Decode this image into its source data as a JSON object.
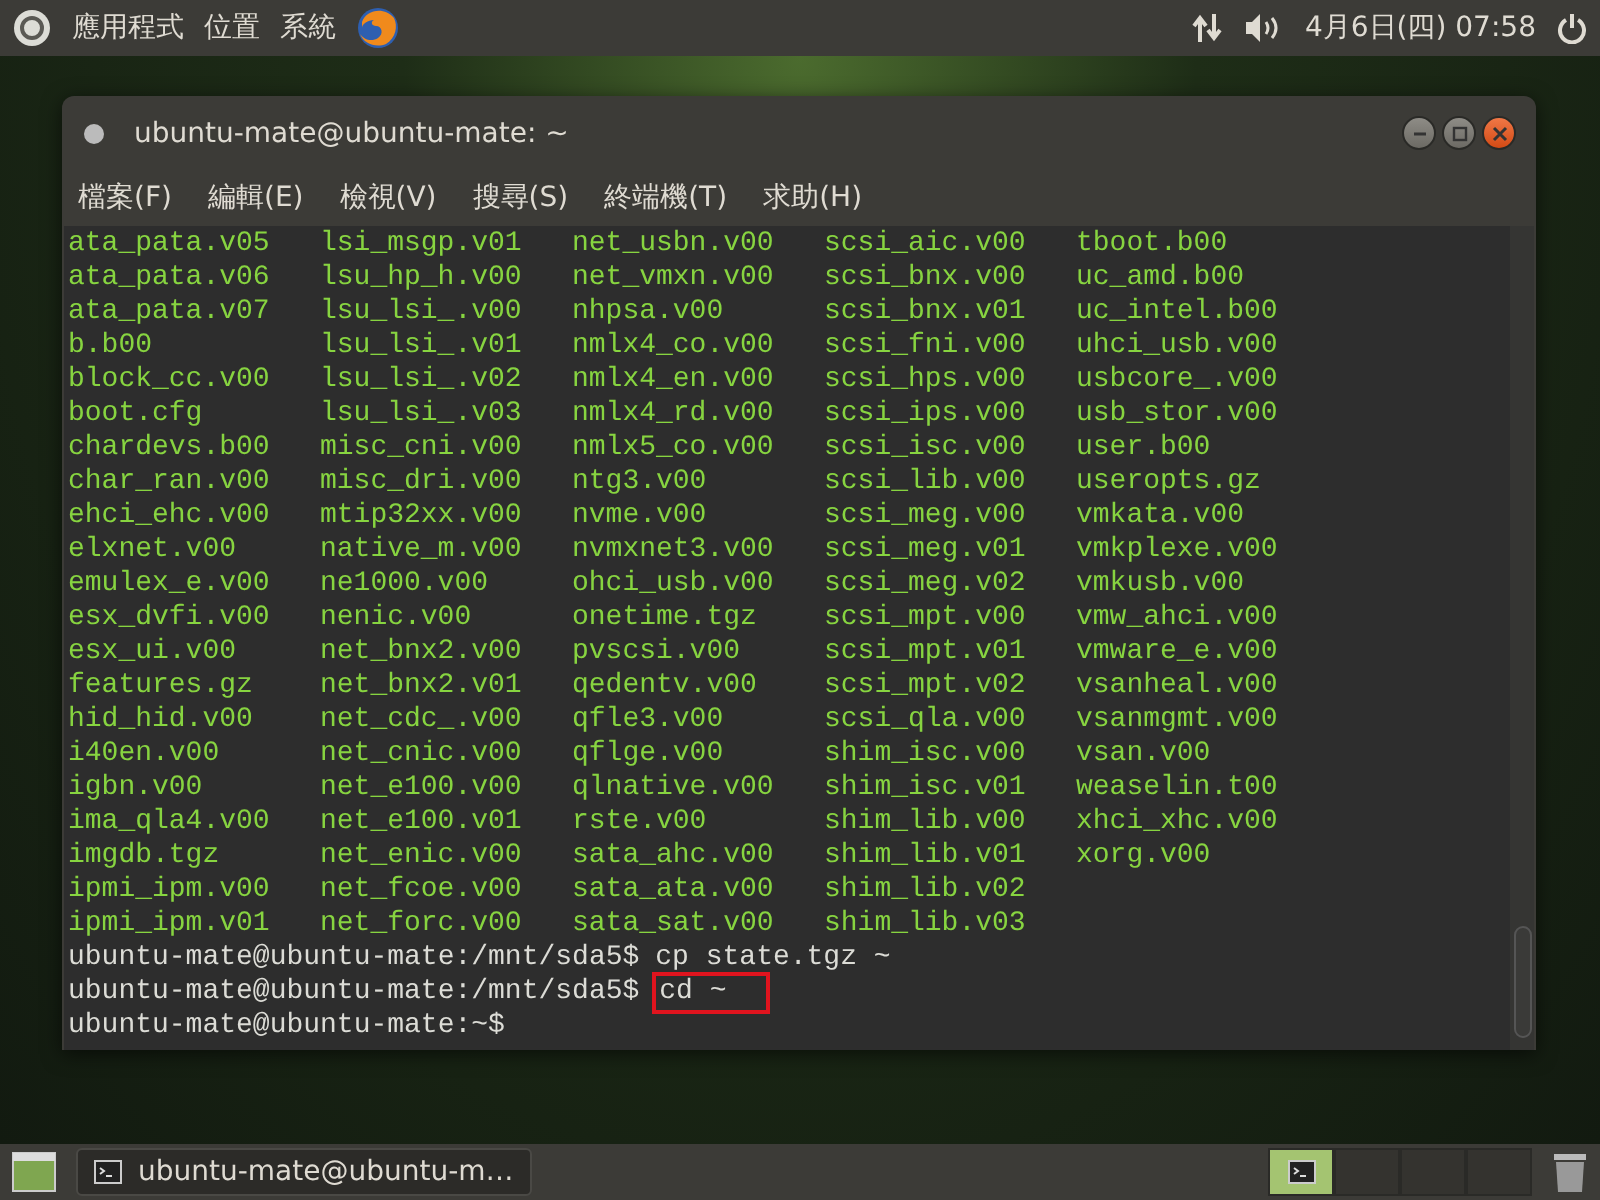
{
  "top_panel": {
    "menus": [
      "應用程式",
      "位置",
      "系統"
    ],
    "clock": "4月6日(四) 07:58"
  },
  "window": {
    "title": "ubuntu-mate@ubuntu-mate: ~",
    "menu": [
      "檔案(F)",
      "編輯(E)",
      "檢視(V)",
      "搜尋(S)",
      "終端機(T)",
      "求助(H)"
    ]
  },
  "terminal": {
    "listing": [
      [
        "ata_pata.v05",
        "lsi_msgp.v01",
        "net_usbn.v00",
        "scsi_aic.v00",
        "tboot.b00"
      ],
      [
        "ata_pata.v06",
        "lsu_hp_h.v00",
        "net_vmxn.v00",
        "scsi_bnx.v00",
        "uc_amd.b00"
      ],
      [
        "ata_pata.v07",
        "lsu_lsi_.v00",
        "nhpsa.v00",
        "scsi_bnx.v01",
        "uc_intel.b00"
      ],
      [
        "b.b00",
        "lsu_lsi_.v01",
        "nmlx4_co.v00",
        "scsi_fni.v00",
        "uhci_usb.v00"
      ],
      [
        "block_cc.v00",
        "lsu_lsi_.v02",
        "nmlx4_en.v00",
        "scsi_hps.v00",
        "usbcore_.v00"
      ],
      [
        "boot.cfg",
        "lsu_lsi_.v03",
        "nmlx4_rd.v00",
        "scsi_ips.v00",
        "usb_stor.v00"
      ],
      [
        "chardevs.b00",
        "misc_cni.v00",
        "nmlx5_co.v00",
        "scsi_isc.v00",
        "user.b00"
      ],
      [
        "char_ran.v00",
        "misc_dri.v00",
        "ntg3.v00",
        "scsi_lib.v00",
        "useropts.gz"
      ],
      [
        "ehci_ehc.v00",
        "mtip32xx.v00",
        "nvme.v00",
        "scsi_meg.v00",
        "vmkata.v00"
      ],
      [
        "elxnet.v00",
        "native_m.v00",
        "nvmxnet3.v00",
        "scsi_meg.v01",
        "vmkplexe.v00"
      ],
      [
        "emulex_e.v00",
        "ne1000.v00",
        "ohci_usb.v00",
        "scsi_meg.v02",
        "vmkusb.v00"
      ],
      [
        "esx_dvfi.v00",
        "nenic.v00",
        "onetime.tgz",
        "scsi_mpt.v00",
        "vmw_ahci.v00"
      ],
      [
        "esx_ui.v00",
        "net_bnx2.v00",
        "pvscsi.v00",
        "scsi_mpt.v01",
        "vmware_e.v00"
      ],
      [
        "features.gz",
        "net_bnx2.v01",
        "qedentv.v00",
        "scsi_mpt.v02",
        "vsanheal.v00"
      ],
      [
        "hid_hid.v00",
        "net_cdc_.v00",
        "qfle3.v00",
        "scsi_qla.v00",
        "vsanmgmt.v00"
      ],
      [
        "i40en.v00",
        "net_cnic.v00",
        "qflge.v00",
        "shim_isc.v00",
        "vsan.v00"
      ],
      [
        "igbn.v00",
        "net_e100.v00",
        "qlnative.v00",
        "shim_isc.v01",
        "weaselin.t00"
      ],
      [
        "ima_qla4.v00",
        "net_e100.v01",
        "rste.v00",
        "shim_lib.v00",
        "xhci_xhc.v00"
      ],
      [
        "imgdb.tgz",
        "net_enic.v00",
        "sata_ahc.v00",
        "shim_lib.v01",
        "xorg.v00"
      ],
      [
        "ipmi_ipm.v00",
        "net_fcoe.v00",
        "sata_ata.v00",
        "shim_lib.v02"
      ],
      [
        "ipmi_ipm.v01",
        "net_forc.v00",
        "sata_sat.v00",
        "shim_lib.v03"
      ]
    ],
    "prompts": [
      {
        "prompt": "ubuntu-mate@ubuntu-mate:/mnt/sda5$",
        "command": "cp state.tgz ~"
      },
      {
        "prompt": "ubuntu-mate@ubuntu-mate:/mnt/sda5$",
        "command": "cd ~",
        "highlighted": true
      },
      {
        "prompt": "ubuntu-mate@ubuntu-mate:~$"
      }
    ]
  },
  "bottom_panel": {
    "tasks": [
      {
        "label": "ubuntu-mate@ubuntu-m…"
      }
    ],
    "workspaces": [
      {
        "selected": true
      },
      {
        "selected": false
      },
      {
        "selected": false
      },
      {
        "selected": false
      }
    ]
  }
}
